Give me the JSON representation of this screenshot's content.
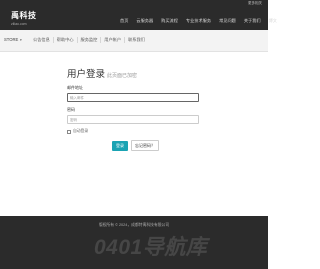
{
  "top_bar": {
    "right_link": "更多相关"
  },
  "header": {
    "logo_name": "禹科技",
    "logo_domain": "ziliao.com"
  },
  "main_nav": {
    "items": [
      {
        "label": "首页",
        "active": true
      },
      {
        "label": "云服务器",
        "active": false
      },
      {
        "label": "购买流程",
        "active": false
      },
      {
        "label": "专业技术服务",
        "active": false
      },
      {
        "label": "常见问题",
        "active": false
      },
      {
        "label": "关于我们",
        "active": false
      },
      {
        "label": "博文",
        "active": false
      }
    ]
  },
  "sub_bar": {
    "store_label": "STORE",
    "items": [
      "公告信息",
      "帮助中心",
      "服务监控",
      "用户帐户",
      "联系我们"
    ]
  },
  "login": {
    "title": "用户登录",
    "subtitle": "此页面已加密",
    "email_label": "邮件地址",
    "email_placeholder": "输入邮件",
    "password_label": "密码",
    "password_placeholder": "密码",
    "remember_label": "自动登录",
    "login_button": "登录",
    "forgot_button": "忘记密码？"
  },
  "footer": {
    "copyright": "版权所有 © 2024，成都特禹科技有限公司",
    "watermark": "0401导航库"
  },
  "colors": {
    "dark_bg": "#2b2b2b",
    "accent": "#1aa3b3",
    "subbar_bg": "#f3f3f3"
  }
}
